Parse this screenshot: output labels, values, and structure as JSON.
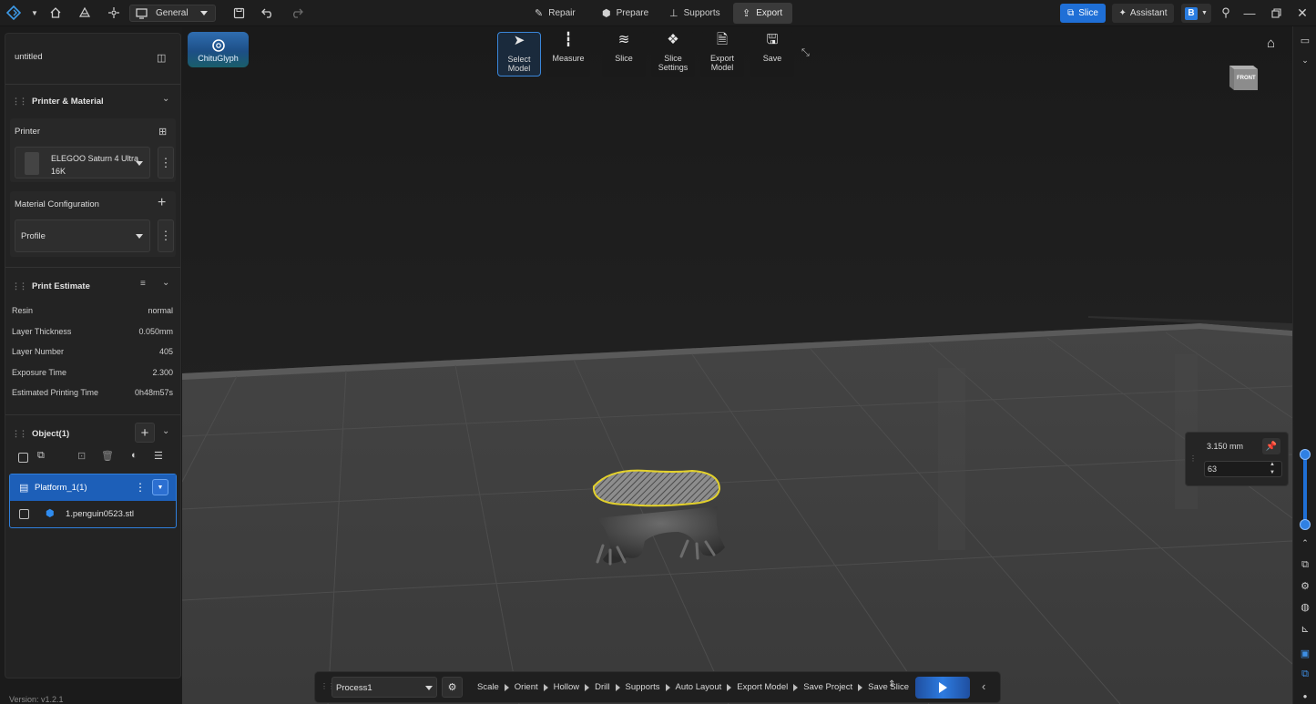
{
  "topbar": {
    "workspace": "General",
    "modes": [
      "Repair",
      "Prepare",
      "Supports",
      "Export"
    ],
    "active_mode": "Export",
    "slice_label": "Slice",
    "assistant_label": "Assistant",
    "b_label": "B"
  },
  "toolbar": {
    "chitu_label": "ChituGlyph",
    "tools": [
      {
        "label": "Select Model"
      },
      {
        "label": "Measure"
      },
      {
        "label": "Slice"
      },
      {
        "label": "Slice Settings"
      },
      {
        "label": "Export Model"
      },
      {
        "label": "Save"
      }
    ]
  },
  "left": {
    "project_name": "untitled",
    "printer_material_title": "Printer & Material",
    "printer_label": "Printer",
    "printer_name_line1": "ELEGOO Saturn 4 Ultra",
    "printer_name_line2": "16K",
    "material_config_label": "Material Configuration",
    "profile_value": "Profile",
    "estimate_title": "Print Estimate",
    "estimates": [
      {
        "label": "Resin",
        "value": "normal"
      },
      {
        "label": "Layer Thickness",
        "value": "0.050mm"
      },
      {
        "label": "Layer Number",
        "value": "405"
      },
      {
        "label": "Exposure Time",
        "value": "2.300"
      },
      {
        "label": "Estimated Printing Time",
        "value": "0h48m57s"
      }
    ],
    "objects_title": "Object(1)",
    "platform_label": "Platform_1(1)",
    "file_name": "1.penguin0523.stl"
  },
  "viewport": {
    "cube_label": "FRONT",
    "layer_height": "3.150 mm",
    "layer_index": "63",
    "slider_fraction": 0.16
  },
  "bottom": {
    "process": "Process1",
    "steps": [
      "Scale",
      "Orient",
      "Hollow",
      "Drill",
      "Supports",
      "Auto Layout",
      "Export Model",
      "Save Project",
      "Save Slice"
    ]
  },
  "footer": {
    "version": "Version: v1.2.1"
  }
}
